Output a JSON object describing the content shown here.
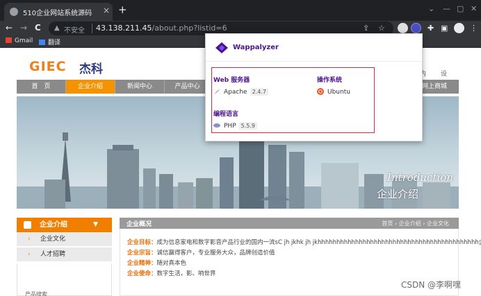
{
  "browser": {
    "tab_title": "510企业网站系统源码",
    "tab_close": "×",
    "new_tab": "+",
    "window_controls": [
      "⌄",
      "—",
      "▢",
      "✕"
    ],
    "nav": {
      "back": "←",
      "forward": "→",
      "reload": "C"
    },
    "address": {
      "security_icon": "▲",
      "security_text": "不安全",
      "host": "43.138.211.45",
      "path": "/about.php?listid=6"
    },
    "bookmarks": [
      {
        "label": "Gmail",
        "icon_color": "#ea4335"
      },
      {
        "label": "翻译",
        "icon_color": "#4285f4"
      }
    ]
  },
  "site": {
    "logo_latin": "GIEC",
    "logo_cn": "杰科",
    "header_links": [
      "内",
      "设"
    ],
    "nav": [
      "首　页",
      "企业介绍",
      "新闻中心",
      "产品中心",
      "网上商城"
    ],
    "active_nav_index": 1,
    "banner": {
      "intro": "Introduction",
      "title": "企业介绍"
    },
    "sidebar": {
      "heading": "企业介绍",
      "heading_arrow": "▼",
      "items": [
        "企业文化",
        "人才招聘"
      ],
      "bullet": "›",
      "next_heading": "产品搜索"
    },
    "content": {
      "heading": "企业概况",
      "breadcrumb": "首页 › 企业介绍 › 企业文化",
      "lines": [
        {
          "key": "企业目标：",
          "text": "成为信息家电和数字影音产品行业的国内一流sC jh jkhk jh jkhhhhhhhhhhhhhhhhhhhhhhhhhhhhhhhhhhhhhhhhhhh企业"
        },
        {
          "key": "企业宗旨：",
          "text": "诚信赢得客户，专业服务大众，品牌创造价值"
        },
        {
          "key": "企业精神：",
          "text": "随对真本色"
        },
        {
          "key": "企业使命：",
          "text": "数字生活，影、响世界"
        }
      ]
    }
  },
  "wappalyzer": {
    "brand": "Wappalyzer",
    "categories": [
      {
        "name": "Web 服务器",
        "tech": "Apache",
        "version": "2.4.7",
        "icon": "apache-feather-icon"
      },
      {
        "name": "操作系统",
        "tech": "Ubuntu",
        "version": "",
        "icon": "ubuntu-icon"
      },
      {
        "name": "编程语言",
        "tech": "PHP",
        "version": "5.5.9",
        "icon": "php-icon"
      }
    ]
  },
  "watermark": "CSDN @李啊嘿",
  "colors": {
    "accent_orange": "#f07f00",
    "wappalyzer_purple": "#4a148c",
    "highlight_red": "#d6293e"
  }
}
